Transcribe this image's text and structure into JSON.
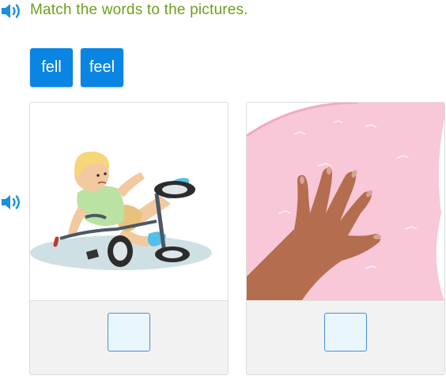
{
  "instruction": {
    "text": "Match the words to the pictures."
  },
  "words": [
    {
      "label": "fell"
    },
    {
      "label": "feel"
    }
  ],
  "pictures": [
    {
      "icon": "child-falling-off-tricycle-picture",
      "answer": ""
    },
    {
      "icon": "hand-on-pink-fluffy-blanket-picture",
      "answer": ""
    }
  ],
  "colors": {
    "accent_text": "#6e9e1e",
    "button_blue": "#0a85e3",
    "speaker_blue": "#1a8fde",
    "drop_area_bg": "#f2f2f2",
    "drop_box_border": "#4a90d9"
  },
  "icons": {
    "audio": "speaker-icon"
  }
}
